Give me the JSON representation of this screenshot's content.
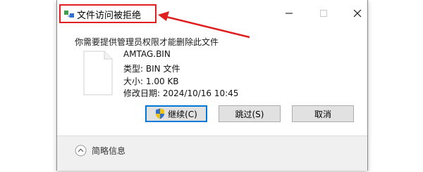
{
  "dialog": {
    "title": "文件访问被拒绝",
    "message": "你需要提供管理员权限才能删除此文件"
  },
  "file": {
    "name": "AMTAG.BIN",
    "type_label": "类型:",
    "type_value": "BIN 文件",
    "size_label": "大小:",
    "size_value": "1.00 KB",
    "modified_label": "修改日期:",
    "modified_value": "2024/10/16 10:45"
  },
  "buttons": {
    "continue_label": "继续(C)",
    "skip_label": "跳过(S)",
    "cancel_label": "取消"
  },
  "footer": {
    "details_label": "简略信息"
  },
  "colors": {
    "annotation_red": "#e02020",
    "focus_blue": "#0078d7"
  }
}
